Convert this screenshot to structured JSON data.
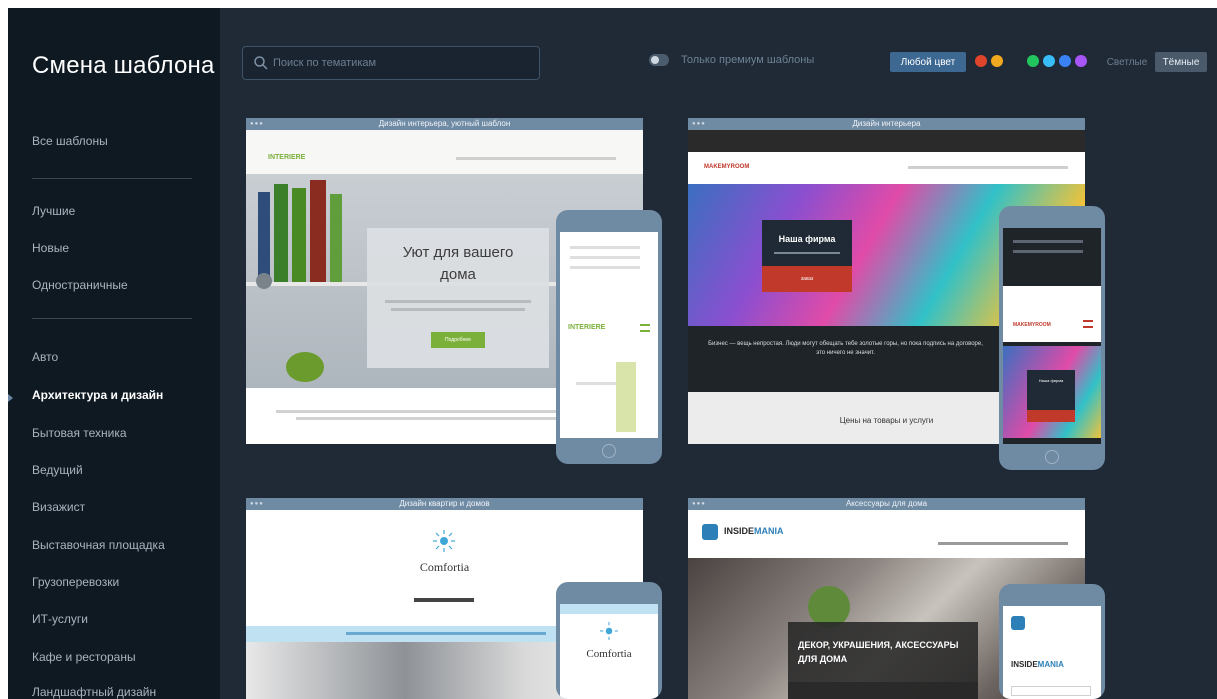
{
  "sidebar": {
    "title": "Смена шаблона",
    "all_templates": "Все шаблоны",
    "group1": [
      "Лучшие",
      "Новые",
      "Одностраничные"
    ],
    "categories": [
      "Авто",
      "Архитектура и дизайн",
      "Бытовая техника",
      "Ведущий",
      "Визажист",
      "Выставочная площадка",
      "Грузоперевозки",
      "ИТ-услуги",
      "Кафе и рестораны",
      "Ландшафтный дизайн"
    ],
    "active_category": "Архитектура и дизайн"
  },
  "toolbar": {
    "search_placeholder": "Поиск по тематикам",
    "free_toggle_label": "Только премиум шаблоны",
    "any_color_label": "Любой цвет",
    "swatches": [
      "#e0452b",
      "#f0a81e",
      "#1f2a36",
      "#22c55e",
      "#38bdf8",
      "#3b82f6",
      "#a855f7"
    ],
    "theme_light": "Светлые",
    "theme_dark": "Тёмные"
  },
  "templates": [
    {
      "title": "Дизайн интерьера, уютный шаблон",
      "brand": "INTERIERE",
      "headline_line1": "Уют для вашего",
      "headline_line2": "дома",
      "cta": "Подробнее"
    },
    {
      "title": "Дизайн интерьера",
      "brand": "MAKEMYROOM",
      "hero_title": "Наша фирма",
      "cta": "заказ",
      "quote": "Бизнес — вещь непростая. Люди могут обещать тебе золотые горы, но пока подпись на договоре, это ничего не значит.",
      "prices": "Цены на товары и услуги"
    },
    {
      "title": "Дизайн квартир и домов",
      "brand": "Comfortia"
    },
    {
      "title": "Аксессуары для дома",
      "brand_part1": "INSIDE",
      "brand_part2": "MANIA",
      "headline_line1": "ДЕКОР, УКРАШЕНИЯ, АКСЕССУАРЫ",
      "headline_line2": "ДЛЯ ДОМА"
    }
  ]
}
